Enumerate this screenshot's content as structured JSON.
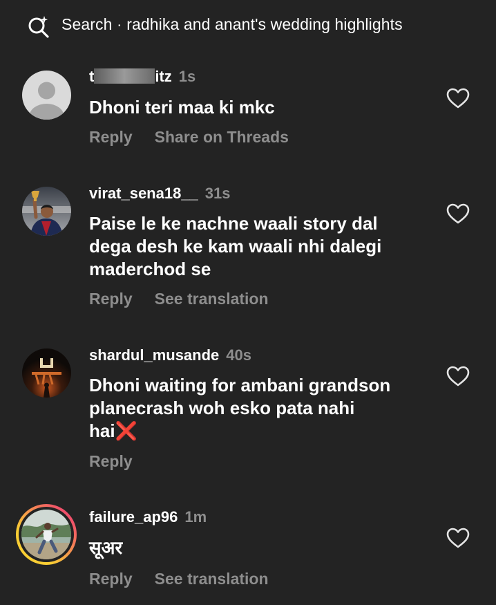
{
  "search": {
    "prefix": "Search · ",
    "query": "radhika and anant's wedding highlights",
    "icon": "search-sparkle-icon"
  },
  "colors": {
    "background": "#232323",
    "text_primary": "#ffffff",
    "text_secondary": "#8e8e8e",
    "story_ring_start": "#f9ce34",
    "story_ring_end": "#ee2a7b"
  },
  "comments": [
    {
      "username_start": "t",
      "username_end": "itz",
      "time": "1s",
      "text": "Dhoni teri maa ki mkc",
      "action_reply": "Reply",
      "action_second": "Share on Threads",
      "avatar": "default-avatar"
    },
    {
      "username": "virat_sena18__",
      "time": "31s",
      "text_lines": [
        "Paise le ke nachne waali story dal",
        "dega desh ke kam waali nhi dalegi",
        "maderchod se"
      ],
      "action_reply": "Reply",
      "action_second": "See translation",
      "avatar": "trophy-player-avatar"
    },
    {
      "username": "shardul_musande",
      "time": "40s",
      "text_lines": [
        "Dhoni waiting for ambani grandson",
        "planecrash woh esko pata nahi",
        "hai"
      ],
      "text_emoji": "❌",
      "action_reply": "Reply",
      "avatar": "poster-avatar"
    },
    {
      "username": "failure_ap96",
      "time": "1m",
      "text": "सूअर",
      "action_reply": "Reply",
      "action_second": "See translation",
      "avatar": "story-ring-avatar"
    }
  ]
}
